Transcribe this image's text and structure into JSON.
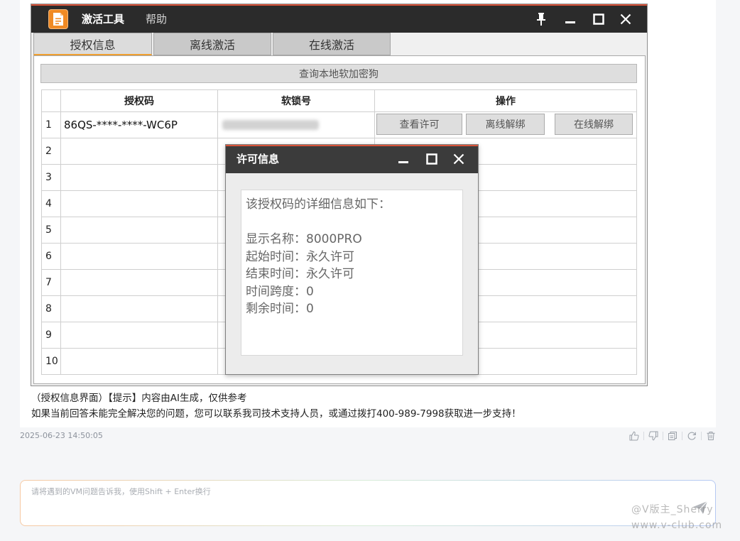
{
  "app": {
    "title": "激活工具",
    "help_menu": "帮助",
    "icons": {
      "app": "document-icon",
      "pin": "pin-icon",
      "minimize": "minimize-icon",
      "maximize": "maximize-icon",
      "close": "close-icon"
    },
    "tabs": [
      {
        "label": "授权信息",
        "active": true
      },
      {
        "label": "离线激活",
        "active": false
      },
      {
        "label": "在线激活",
        "active": false
      }
    ],
    "query_button": "查询本地软加密狗",
    "table": {
      "headers": {
        "index": "",
        "auth_code": "授权码",
        "soft_lock": "软锁号",
        "actions": "操作"
      },
      "rows": [
        {
          "index": "1",
          "auth_code": "86QS-****-****-WC6P",
          "actions": [
            "查看许可",
            "离线解绑",
            "在线解绑"
          ]
        },
        {
          "index": "2"
        },
        {
          "index": "3"
        },
        {
          "index": "4"
        },
        {
          "index": "5"
        },
        {
          "index": "6"
        },
        {
          "index": "7"
        },
        {
          "index": "8"
        },
        {
          "index": "9"
        },
        {
          "index": "10"
        }
      ]
    },
    "modal": {
      "title": "许可信息",
      "intro": "该授权码的详细信息如下：",
      "fields": [
        {
          "label": "显示名称：",
          "value": "8000PRO"
        },
        {
          "label": "起始时间：",
          "value": "永久许可"
        },
        {
          "label": "结束时间：",
          "value": "永久许可"
        },
        {
          "label": "时间跨度：",
          "value": "0"
        },
        {
          "label": "剩余时间：",
          "value": "0"
        }
      ]
    }
  },
  "message": {
    "caption": "（授权信息界面）【提示】内容由AI生成，仅供参考",
    "support_note": "如果当前回答未能完全解决您的问题，您可以联系我司技术支持人员，或通过拨打400-989-7998获取进一步支持！",
    "timestamp": "2025-06-23 14:50:05",
    "action_icons": [
      "thumbs-up-icon",
      "thumbs-down-icon",
      "copy-icon",
      "refresh-icon",
      "delete-icon"
    ]
  },
  "composer": {
    "placeholder": "请将遇到的VM问题告诉我，使用Shift + Enter换行",
    "send_icon": "send-icon"
  },
  "watermark": {
    "handle": "@V版主_Sherry",
    "site": "www.v-club.com"
  },
  "colors": {
    "page_background": "#f5f6f8",
    "title_bar": "#2b2b2b",
    "modal_title_bar": "#3b3b3b",
    "accent_line": "#d9543a",
    "app_icon": "#f08a24",
    "active_tab_underline": "#f0a030"
  }
}
